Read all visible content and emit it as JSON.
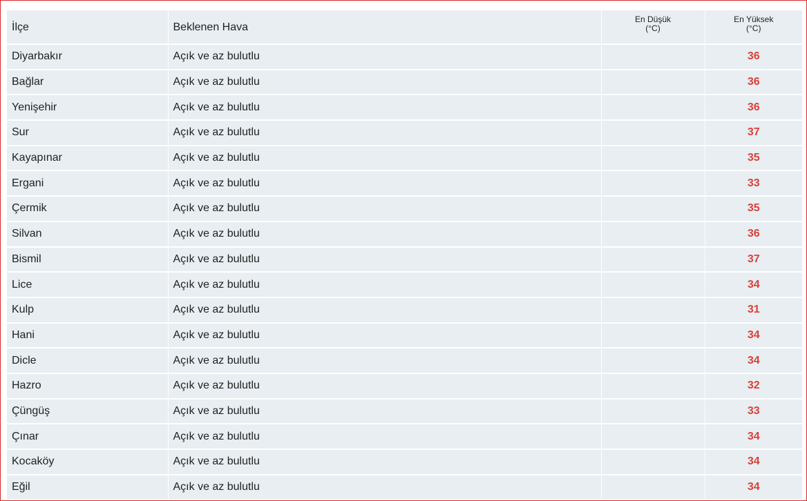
{
  "table": {
    "headers": {
      "district": "İlçe",
      "weather": "Beklenen Hava",
      "min_line1": "En Düşük",
      "min_line2": "(°C)",
      "max_line1": "En Yüksek",
      "max_line2": "(°C)"
    },
    "accent_color": "#d9403a",
    "rows": [
      {
        "district": "Diyarbakır",
        "weather": "Açık ve az bulutlu",
        "min": "",
        "max": "36"
      },
      {
        "district": "Bağlar",
        "weather": "Açık ve az bulutlu",
        "min": "",
        "max": "36"
      },
      {
        "district": "Yenişehir",
        "weather": "Açık ve az bulutlu",
        "min": "",
        "max": "36"
      },
      {
        "district": "Sur",
        "weather": "Açık ve az bulutlu",
        "min": "",
        "max": "37"
      },
      {
        "district": "Kayapınar",
        "weather": "Açık ve az bulutlu",
        "min": "",
        "max": "35"
      },
      {
        "district": "Ergani",
        "weather": "Açık ve az bulutlu",
        "min": "",
        "max": "33"
      },
      {
        "district": "Çermik",
        "weather": "Açık ve az bulutlu",
        "min": "",
        "max": "35"
      },
      {
        "district": "Silvan",
        "weather": "Açık ve az bulutlu",
        "min": "",
        "max": "36"
      },
      {
        "district": "Bismil",
        "weather": "Açık ve az bulutlu",
        "min": "",
        "max": "37"
      },
      {
        "district": "Lice",
        "weather": "Açık ve az bulutlu",
        "min": "",
        "max": "34"
      },
      {
        "district": "Kulp",
        "weather": "Açık ve az bulutlu",
        "min": "",
        "max": "31"
      },
      {
        "district": "Hani",
        "weather": "Açık ve az bulutlu",
        "min": "",
        "max": "34"
      },
      {
        "district": "Dicle",
        "weather": "Açık ve az bulutlu",
        "min": "",
        "max": "34"
      },
      {
        "district": "Hazro",
        "weather": "Açık ve az bulutlu",
        "min": "",
        "max": "32"
      },
      {
        "district": "Çüngüş",
        "weather": "Açık ve az bulutlu",
        "min": "",
        "max": "33"
      },
      {
        "district": "Çınar",
        "weather": "Açık ve az bulutlu",
        "min": "",
        "max": "34"
      },
      {
        "district": "Kocaköy",
        "weather": "Açık ve az bulutlu",
        "min": "",
        "max": "34"
      },
      {
        "district": "Eğil",
        "weather": "Açık ve az bulutlu",
        "min": "",
        "max": "34"
      }
    ]
  }
}
